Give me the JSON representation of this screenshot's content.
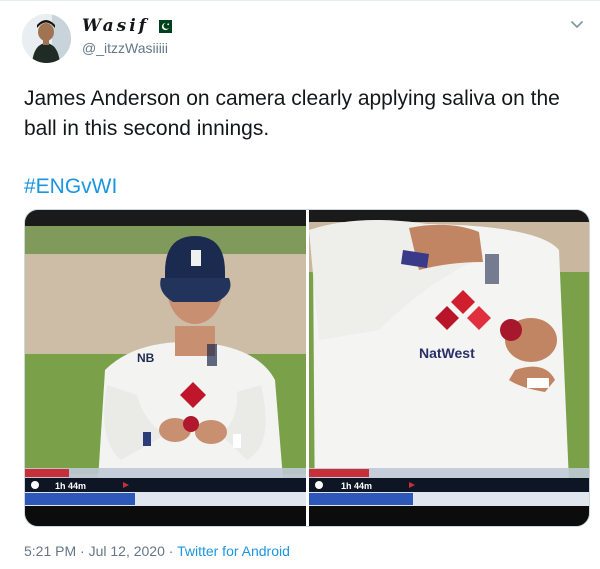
{
  "tweet": {
    "display_name": "Wasif",
    "handle": "@_itzzWasiiiii",
    "text": "James Anderson on camera clearly applying saliva on the ball in this second innings.",
    "hashtag": "#ENGvWI",
    "time": "5:21 PM · Jul 12, 2020 · ",
    "source": "Twitter for Android"
  },
  "media": {
    "photos": [
      {
        "scoreboard_time": "1h 44m",
        "shirt_sponsor": "",
        "shirt_brand": "NB"
      },
      {
        "scoreboard_time": "1h 44m",
        "shirt_sponsor": "NatWest",
        "shirt_brand": ""
      }
    ]
  },
  "colors": {
    "accent": "#1b95e0",
    "secondary_text": "#657786",
    "pakistan_flag_green": "#01411c"
  },
  "icons": {
    "flag": "pakistan-flag-icon",
    "caret": "chevron-down-icon"
  }
}
